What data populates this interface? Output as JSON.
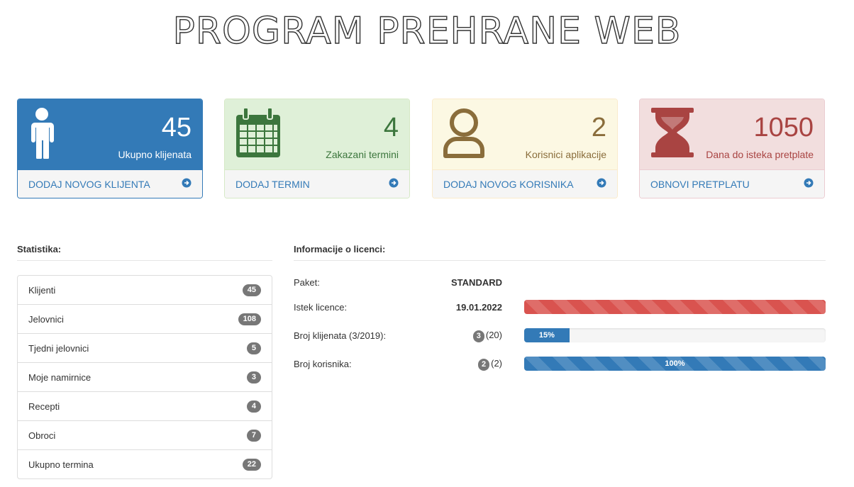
{
  "app": {
    "title": "PROGRAM PREHRANE WEB"
  },
  "panels": [
    {
      "number": "45",
      "label": "Ukupno klijenata",
      "action": "DODAJ NOVOG KLIJENTA",
      "icon": "user-icon"
    },
    {
      "number": "4",
      "label": "Zakazani termini",
      "action": "DODAJ TERMIN",
      "icon": "calendar-icon"
    },
    {
      "number": "2",
      "label": "Korisnici aplikacije",
      "action": "DODAJ NOVOG KORISNIKA",
      "icon": "user-outline-icon"
    },
    {
      "number": "1050",
      "label": "Dana do isteka pretplate",
      "action": "OBNOVI PRETPLATU",
      "icon": "hourglass-icon"
    }
  ],
  "colors": {
    "primary": "#337ab7",
    "success": "#3c763d",
    "warning": "#8a6d3b",
    "danger": "#a94442"
  },
  "stats": {
    "title": "Statistika:",
    "items": [
      {
        "label": "Klijenti",
        "count": "45"
      },
      {
        "label": "Jelovnici",
        "count": "108"
      },
      {
        "label": "Tjedni jelovnici",
        "count": "5"
      },
      {
        "label": "Moje namirnice",
        "count": "3"
      },
      {
        "label": "Recepti",
        "count": "4"
      },
      {
        "label": "Obroci",
        "count": "7"
      },
      {
        "label": "Ukupno termina",
        "count": "22"
      }
    ]
  },
  "license": {
    "title": "Informacije o licenci:",
    "package_label": "Paket:",
    "package_value": "STANDARD",
    "expiry_label": "Istek licence:",
    "expiry_value": "19.01.2022",
    "expiry_progress": 100,
    "clients_label": "Broj klijenata (3/2019):",
    "clients_used": "3",
    "clients_max": "(20)",
    "clients_progress": 15,
    "clients_progress_text": "15%",
    "users_label": "Broj korisnika:",
    "users_used": "2",
    "users_max": "(2)",
    "users_progress": 100,
    "users_progress_text": "100%"
  }
}
